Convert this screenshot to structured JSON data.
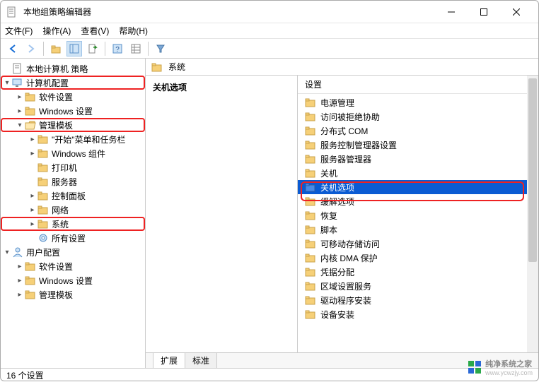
{
  "window": {
    "title": "本地组策略编辑器"
  },
  "menu": {
    "file": "文件(F)",
    "action": "操作(A)",
    "view": "查看(V)",
    "help": "帮助(H)"
  },
  "toolbar_icons": [
    "back",
    "forward",
    "up",
    "grid",
    "export",
    "refresh",
    "help-prop",
    "list-detail",
    "filter"
  ],
  "tree": {
    "root": "本地计算机 策略",
    "computer_config": "计算机配置",
    "software_settings": "软件设置",
    "windows_settings": "Windows 设置",
    "admin_templates": "管理模板",
    "start_taskbar": "\"开始\"菜单和任务栏",
    "windows_components": "Windows 组件",
    "printers": "打印机",
    "servers": "服务器",
    "control_panel": "控制面板",
    "network": "网络",
    "system": "系统",
    "all_settings": "所有设置",
    "user_config": "用户配置",
    "u_software_settings": "软件设置",
    "u_windows_settings": "Windows 设置",
    "u_admin_templates": "管理模板"
  },
  "crumb": {
    "label": "系统"
  },
  "list_left": {
    "selected_heading": "关机选项"
  },
  "list": {
    "header": "设置",
    "items": [
      "电源管理",
      "访问被拒绝协助",
      "分布式 COM",
      "服务控制管理器设置",
      "服务器管理器",
      "关机",
      "关机选项",
      "缓解选项",
      "恢复",
      "脚本",
      "可移动存储访问",
      "内核 DMA 保护",
      "凭据分配",
      "区域设置服务",
      "驱动程序安装",
      "设备安装"
    ],
    "selected_index": 6
  },
  "tabs": {
    "extended": "扩展",
    "standard": "标准"
  },
  "status": {
    "text": "16 个设置"
  },
  "watermark": {
    "brand": "纯净系统之家",
    "url": "www.ycwzjy.com"
  }
}
